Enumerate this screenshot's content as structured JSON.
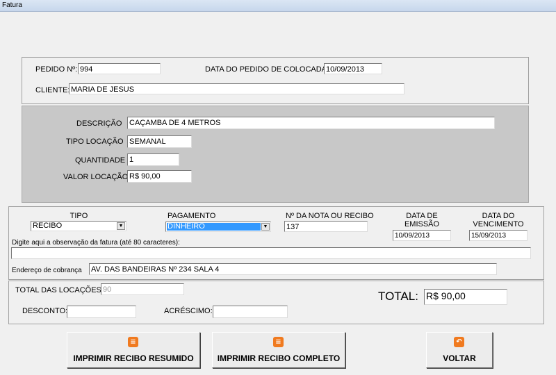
{
  "window": {
    "title": "Fatura"
  },
  "header": {
    "pedido_label": "PEDIDO Nº:",
    "pedido_value": "994",
    "data_pedido_label": "DATA DO PEDIDO DE COLOCADA:",
    "data_pedido_value": "10/09/2013",
    "cliente_label": "CLIENTE:",
    "cliente_value": "MARIA DE JESUS"
  },
  "item": {
    "descricao_label": "DESCRIÇÃO",
    "descricao_value": "CAÇAMBA DE 4 METROS",
    "tipo_locacao_label": "TIPO LOCAÇÃO",
    "tipo_locacao_value": "SEMANAL",
    "quantidade_label": "QUANTIDADE",
    "quantidade_value": "1",
    "valor_locacao_label": "VALOR LOCAÇÃO",
    "valor_locacao_value": "R$ 90,00"
  },
  "invoice": {
    "tipo_label": "TIPO",
    "tipo_value": "RECIBO",
    "pagamento_label": "PAGAMENTO",
    "pagamento_value": "DINHEIRO",
    "nota_label": "Nº DA NOTA OU RECIBO",
    "nota_value": "137",
    "emissao_label_1": "DATA DE",
    "emissao_label_2": "EMISSÃO",
    "emissao_value": "10/09/2013",
    "vencimento_label_1": "DATA DO",
    "vencimento_label_2": "VENCIMENTO",
    "vencimento_value": "15/09/2013",
    "observacao_label": "Digite aqui a observação da fatura (até 80 caracteres):",
    "observacao_value": "",
    "endereco_label": "Endereço de cobrança",
    "endereco_value": "AV. DAS BANDEIRAS Nº 234  SALA 4"
  },
  "totals": {
    "total_locacoes_label": "TOTAL DAS LOCAÇÕES:",
    "total_locacoes_value": "90",
    "desconto_label": "DESCONTO:",
    "desconto_value": "",
    "acrescimo_label": "ACRÉSCIMO:",
    "acrescimo_value": "",
    "total_label": "TOTAL:",
    "total_value": "R$ 90,00"
  },
  "buttons": {
    "resumido_label": "IMPRIMIR RECIBO RESUMIDO",
    "completo_label": "IMPRIMIR RECIBO COMPLETO",
    "voltar_label": "VOLTAR",
    "resumido_icon": "document-icon",
    "completo_icon": "document-icon",
    "voltar_icon": "back-arrow-icon"
  },
  "colors": {
    "icon_accent": "#f07a1f",
    "selection": "#3399ff",
    "item_panel_bg": "#c8c8c8"
  }
}
